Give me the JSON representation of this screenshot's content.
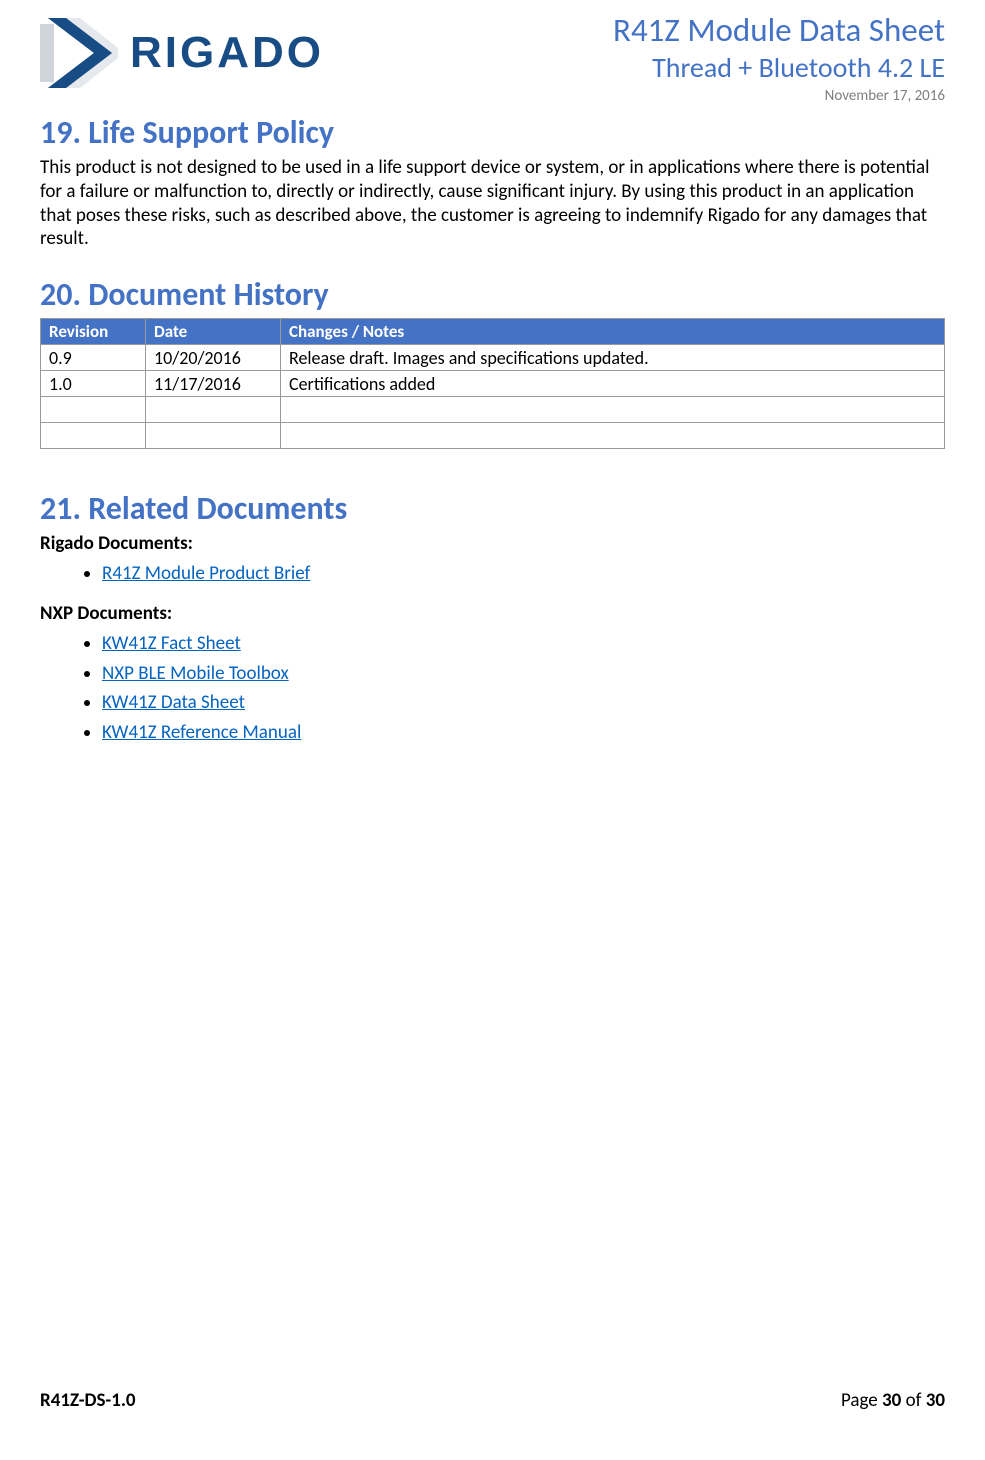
{
  "header": {
    "logo_text": "RIGADO",
    "doc_title": "R41Z Module Data Sheet",
    "doc_subtitle": "Thread + Bluetooth 4.2 LE",
    "doc_date": "November 17, 2016"
  },
  "sections": {
    "s19": {
      "heading": "19.  Life Support Policy",
      "body": "This product is not designed to be used in a life support device or system, or in applications where there is potential for a failure or malfunction to, directly or indirectly, cause significant injury. By using this product in an application that poses these risks, such as described above, the customer is agreeing to indemnify Rigado for any damages that result."
    },
    "s20": {
      "heading": "20.  Document History",
      "table": {
        "headers": [
          "Revision",
          "Date",
          "Changes / Notes"
        ],
        "rows": [
          [
            "0.9",
            "10/20/2016",
            "Release draft. Images and specifications updated."
          ],
          [
            "1.0",
            "11/17/2016",
            "Certifications added"
          ],
          [
            "",
            "",
            ""
          ],
          [
            "",
            "",
            ""
          ]
        ]
      }
    },
    "s21": {
      "heading": "21.  Related Documents",
      "rigado_label": "Rigado Documents:",
      "rigado_links": [
        "R41Z Module Product Brief"
      ],
      "nxp_label": "NXP Documents:",
      "nxp_links": [
        "KW41Z Fact Sheet",
        "NXP BLE Mobile Toolbox",
        "KW41Z Data Sheet",
        "KW41Z Reference Manual"
      ]
    }
  },
  "footer": {
    "left": "R41Z-DS-1.0",
    "page_prefix": "Page ",
    "page_current": "30",
    "page_of": " of ",
    "page_total": "30"
  }
}
